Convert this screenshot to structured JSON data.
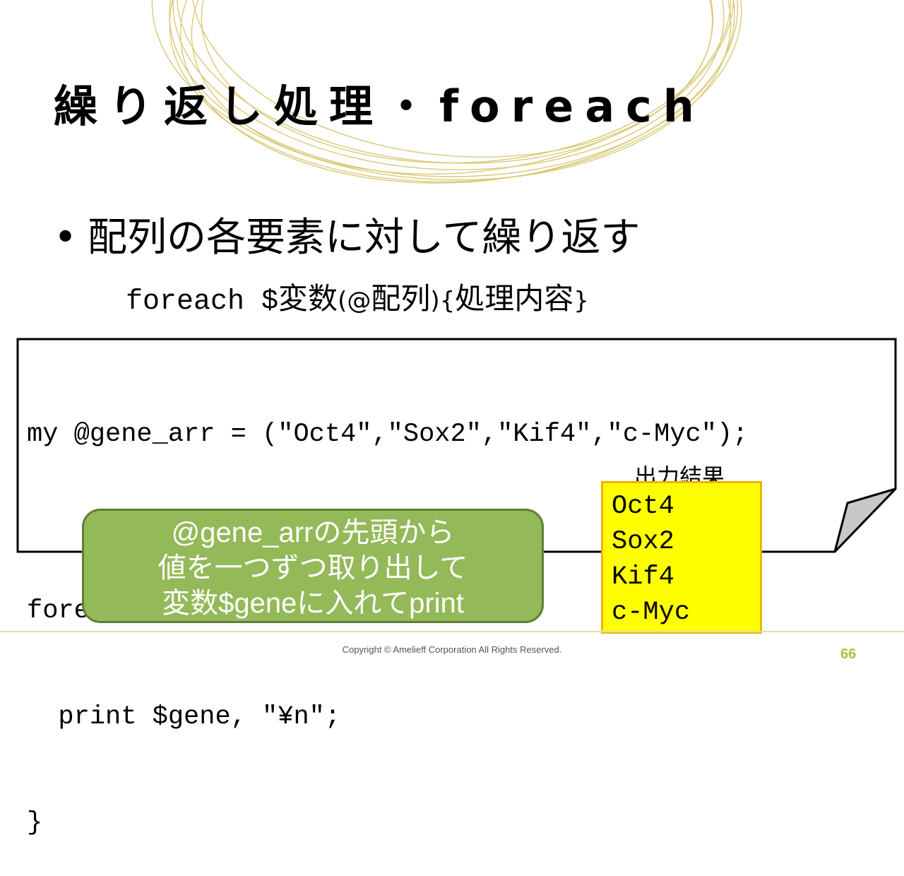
{
  "slide": {
    "title": "繰り返し処理・foreach",
    "bullet_symbol": "•",
    "bullet_text": "配列の各要素に対して繰り返す",
    "syntax": {
      "keyword": "foreach $",
      "var": "変数",
      "lparen": "(",
      "array_sigil": "@",
      "array": "配列",
      "rparen": ")",
      "lbrace": "{",
      "body": "処理内容",
      "rbrace": "}"
    },
    "code_lines": [
      "my @gene_arr = (\"Oct4\",\"Sox2\",\"Kif4\",\"c-Myc\");",
      "",
      "foreach my $gene(@gene_arr){",
      "  print $gene, \"¥n\";",
      "}"
    ],
    "output_label": "出力結果",
    "output_lines": [
      "Oct4",
      "Sox2",
      "Kif4",
      "c-Myc"
    ],
    "callout_lines": [
      "@gene_arrの先頭から",
      "値を一つずつ取り出して",
      "変数$geneに入れてprint"
    ],
    "copyright": "Copyright © Amelieff Corporation All Rights Reserved.",
    "page_number": "66"
  },
  "colors": {
    "callout_fill": "#94b959",
    "callout_border": "#5f7f36",
    "output_fill": "#ffff00",
    "output_border": "#f0b400",
    "swirl": "#d4c060",
    "page_number": "#a8c43c"
  },
  "icons": {
    "decoration": "gold-swirl-rings",
    "code_box_corner": "page-curl"
  }
}
